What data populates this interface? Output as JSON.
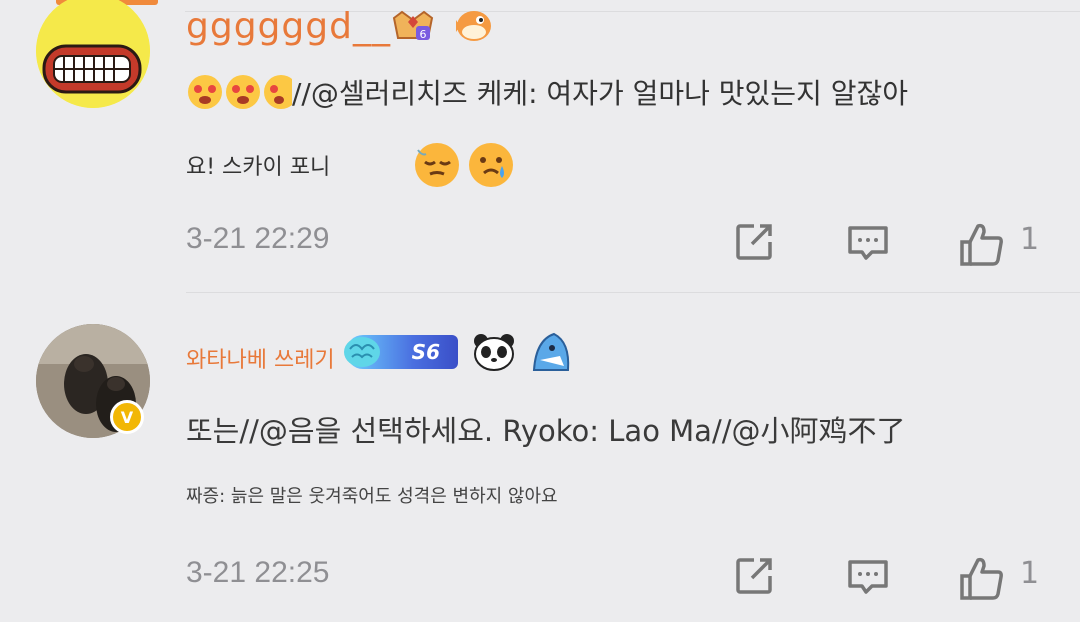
{
  "comments": [
    {
      "username": "ggggggd__",
      "text_line1": "//@셀러리치즈 케케: 여자가 얼마나 맛있는지 알잖아",
      "text_line2": "요! 스카이 포니",
      "time": "3-21 22:29",
      "likes": "1",
      "icons": [
        "crown-badge-6",
        "puffer-fish-badge",
        "heart-eyes-emoji",
        "sad-emoji",
        "tear-emoji"
      ]
    },
    {
      "username": "와타나베 쓰레기",
      "text_line1": "또는//@음을 선택하세요. Ryoko: Lao Ma//@小阿鸡不了",
      "text_line2": "짜증: 늙은 말은 웃겨죽어도 성격은 변하지 않아요",
      "badge_label": "S6",
      "time": "3-21 22:25",
      "likes": "1",
      "icons": [
        "brain-s6-badge",
        "panda-badge",
        "shark-badge",
        "verified-badge"
      ]
    }
  ],
  "colors": {
    "background": "#ececee",
    "username": "#e8793a",
    "meta": "#8f8f93",
    "text": "#333333",
    "verified": "#f2b705"
  }
}
